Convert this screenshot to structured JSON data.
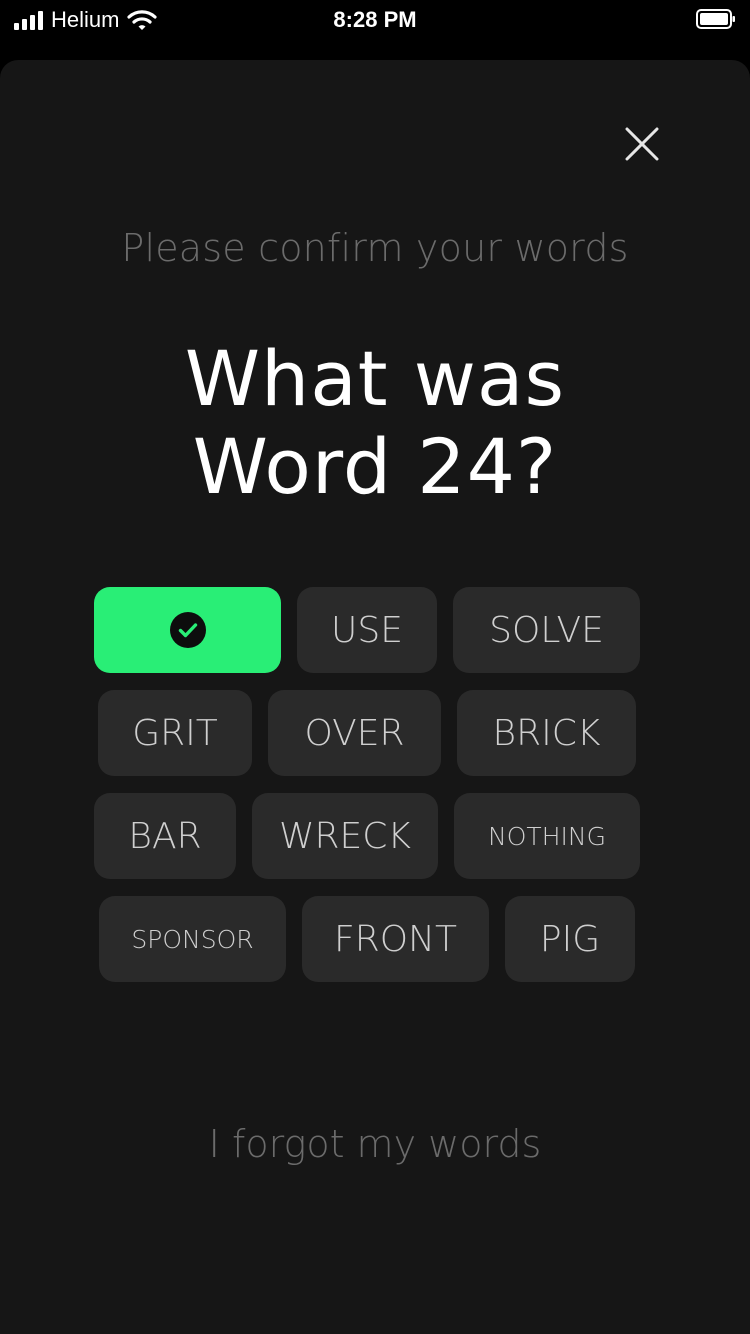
{
  "status_bar": {
    "carrier": "Helium",
    "time": "8:28 PM"
  },
  "colors": {
    "background": "#161616",
    "chip": "#2a2a2a",
    "selected_chip": "#29ee76",
    "muted_text": "#6b6b6b"
  },
  "header": {
    "subtitle": "Please confirm your words",
    "title_line1": "What was",
    "title_line2": "Word 24?"
  },
  "words": [
    {
      "label": "",
      "state": "confirmed",
      "icon": "check-circle-icon"
    },
    {
      "label": "USE"
    },
    {
      "label": "SOLVE"
    },
    {
      "label": "GRIT"
    },
    {
      "label": "OVER"
    },
    {
      "label": "BRICK"
    },
    {
      "label": "BAR"
    },
    {
      "label": "WRECK"
    },
    {
      "label": "NOTHING"
    },
    {
      "label": "SPONSOR"
    },
    {
      "label": "FRONT"
    },
    {
      "label": "PIG"
    }
  ],
  "footer": {
    "forgot_label": "I forgot my words"
  }
}
